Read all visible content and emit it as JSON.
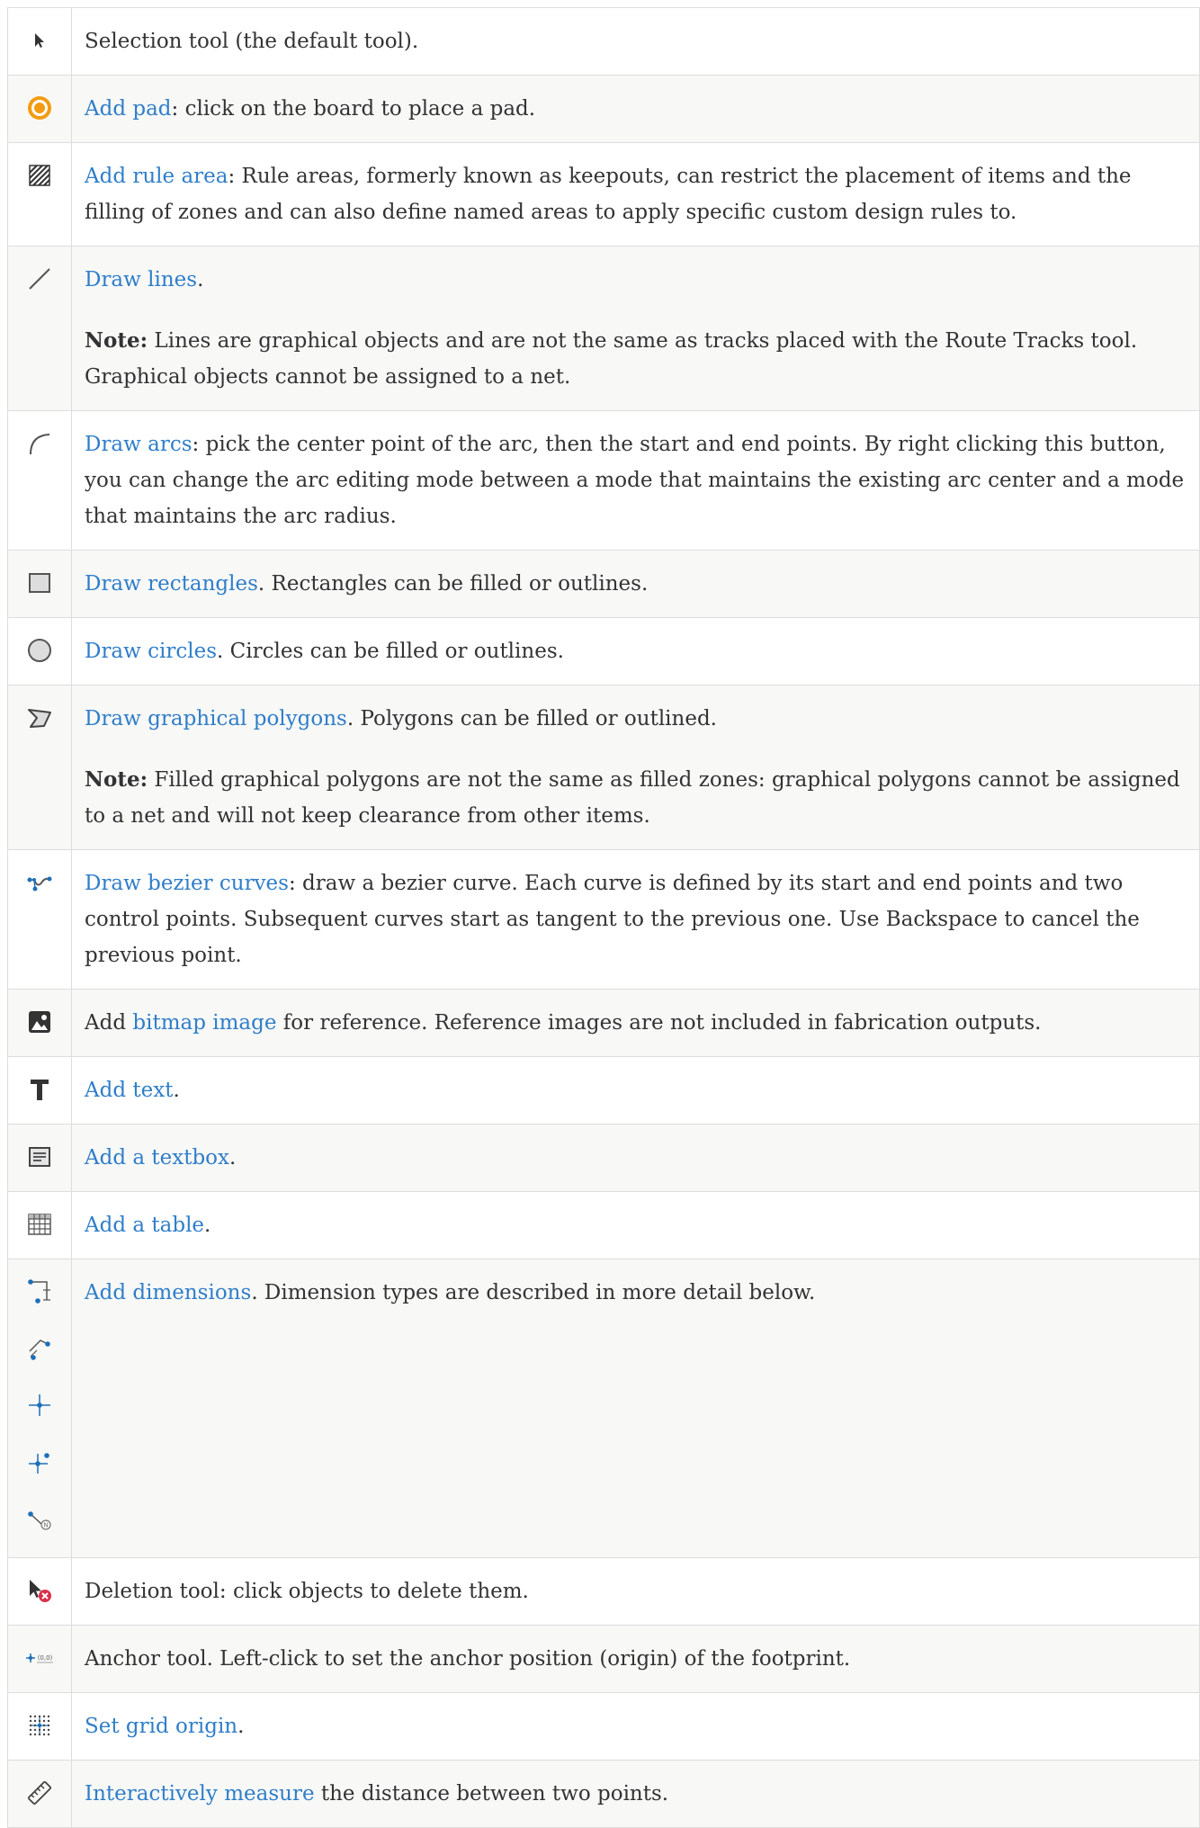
{
  "rows": [
    {
      "icon": "selection-arrow-icon",
      "text": "Selection tool (the default tool)."
    },
    {
      "icon": "add-pad-icon",
      "link": "Add pad",
      "text": ": click on the board to place a pad."
    },
    {
      "icon": "rule-area-icon",
      "link": "Add rule area",
      "text": ": Rule areas, formerly known as keepouts, can restrict the placement of items and the filling of zones and can also define named areas to apply specific custom design rules to."
    },
    {
      "icon": "draw-line-icon",
      "link": "Draw lines",
      "text": ".",
      "note_label": "Note:",
      "note": " Lines are graphical objects and are not the same as tracks placed with the Route Tracks tool. Graphical objects cannot be assigned to a net."
    },
    {
      "icon": "draw-arc-icon",
      "link": "Draw arcs",
      "text": ": pick the center point of the arc, then the start and end points. By right clicking this button, you can change the arc editing mode between a mode that maintains the existing arc center and a mode that maintains the arc radius."
    },
    {
      "icon": "rectangle-icon",
      "link": "Draw rectangles",
      "text": ". Rectangles can be filled or outlines."
    },
    {
      "icon": "circle-icon",
      "link": "Draw circles",
      "text": ". Circles can be filled or outlines."
    },
    {
      "icon": "polygon-icon",
      "link": "Draw graphical polygons",
      "text": ". Polygons can be filled or outlined.",
      "note_label": "Note:",
      "note": " Filled graphical polygons are not the same as filled zones: graphical polygons cannot be assigned to a net and will not keep clearance from other items."
    },
    {
      "icon": "bezier-icon",
      "link": "Draw bezier curves",
      "text": ": draw a bezier curve. Each curve is defined by its start and end points and two control points. Subsequent curves start as tangent to the previous one. Use Backspace to cancel the previous point."
    },
    {
      "icon": "image-icon",
      "pre": "Add ",
      "link": "bitmap image",
      "text": " for reference. Reference images are not included in fabrication outputs."
    },
    {
      "icon": "text-icon",
      "link": "Add text",
      "text": "."
    },
    {
      "icon": "textbox-icon",
      "link": "Add a textbox",
      "text": "."
    },
    {
      "icon": "table-icon",
      "link": "Add a table",
      "text": "."
    },
    {
      "icon": "dimension-icon",
      "link": "Add dimensions",
      "text": ". Dimension types are described in more detail below."
    },
    {
      "icon": "delete-tool-icon",
      "text": "Deletion tool: click objects to delete them."
    },
    {
      "icon": "anchor-icon",
      "icon_text": "(0,0)",
      "text": "Anchor tool. Left-click to set the anchor position (origin) of the footprint."
    },
    {
      "icon": "grid-origin-icon",
      "link": "Set grid origin",
      "text": "."
    },
    {
      "icon": "measure-icon",
      "link": "Interactively measure",
      "text": " the distance between two points."
    }
  ],
  "dimension_icons": [
    "orthogonal-dimension-icon",
    "aligned-dimension-icon",
    "center-dimension-icon",
    "radial-dimension-icon",
    "leader-dimension-icon"
  ],
  "colors": {
    "link": "#2f7ec9",
    "border": "#dddddd",
    "alt_row": "#f8f8f7",
    "text": "#333333",
    "pad_orange": "#f39c12",
    "delete_red": "#d9304b",
    "dim_blue": "#1d6fb8"
  }
}
